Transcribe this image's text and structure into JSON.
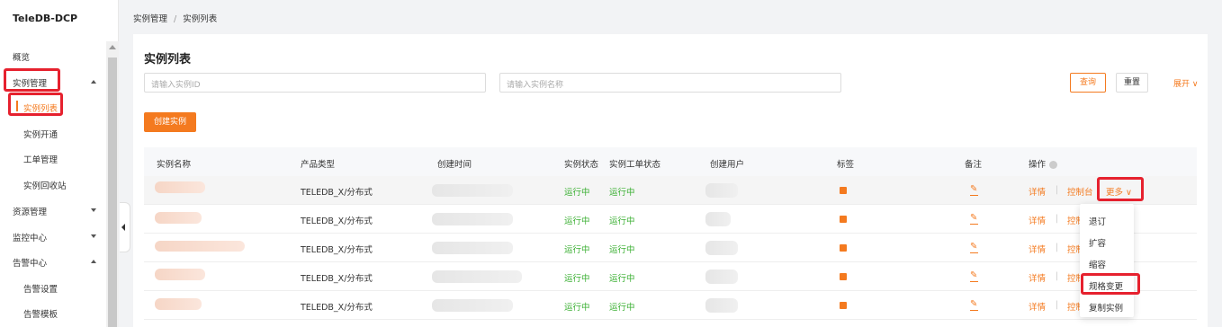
{
  "app": {
    "logo": "TeleDB-DCP"
  },
  "sidebar": {
    "items": [
      {
        "label": "概览"
      },
      {
        "label": "实例管理"
      },
      {
        "label": "实例列表"
      },
      {
        "label": "实例开通"
      },
      {
        "label": "工单管理"
      },
      {
        "label": "实例回收站"
      },
      {
        "label": "资源管理"
      },
      {
        "label": "监控中心"
      },
      {
        "label": "告警中心"
      },
      {
        "label": "告警设置"
      },
      {
        "label": "告警模板"
      }
    ]
  },
  "breadcrumb": {
    "parent": "实例管理",
    "separator": "/",
    "current": "实例列表"
  },
  "page": {
    "title": "实例列表"
  },
  "search": {
    "id_placeholder": "请输入实例ID",
    "name_placeholder": "请输入实例名称",
    "query_label": "查询",
    "reset_label": "重置",
    "expand_label": "展开",
    "create_label": "创建实例"
  },
  "table": {
    "headers": {
      "name": "实例名称",
      "product": "产品类型",
      "created": "创建时间",
      "status": "实例状态",
      "ticket_status": "实例工单状态",
      "creator": "创建用户",
      "tag": "标签",
      "remark": "备注",
      "ops": "操作"
    },
    "rows": [
      {
        "product": "TELEDB_X/分布式",
        "status": "运行中",
        "ticket_status": "运行中"
      },
      {
        "product": "TELEDB_X/分布式",
        "status": "运行中",
        "ticket_status": "运行中"
      },
      {
        "product": "TELEDB_X/分布式",
        "status": "运行中",
        "ticket_status": "运行中"
      },
      {
        "product": "TELEDB_X/分布式",
        "status": "运行中",
        "ticket_status": "运行中"
      },
      {
        "product": "TELEDB_X/分布式",
        "status": "运行中",
        "ticket_status": "运行中"
      }
    ],
    "ops": {
      "detail": "详情",
      "console": "控制台",
      "console_short": "控制",
      "more": "更多"
    }
  },
  "dropdown": {
    "items": [
      {
        "label": "退订"
      },
      {
        "label": "扩容"
      },
      {
        "label": "缩容"
      },
      {
        "label": "规格变更"
      },
      {
        "label": "复制实例"
      }
    ]
  },
  "colors": {
    "accent": "#f47a1f",
    "success": "#3cb034",
    "highlight": "#e6212e"
  }
}
